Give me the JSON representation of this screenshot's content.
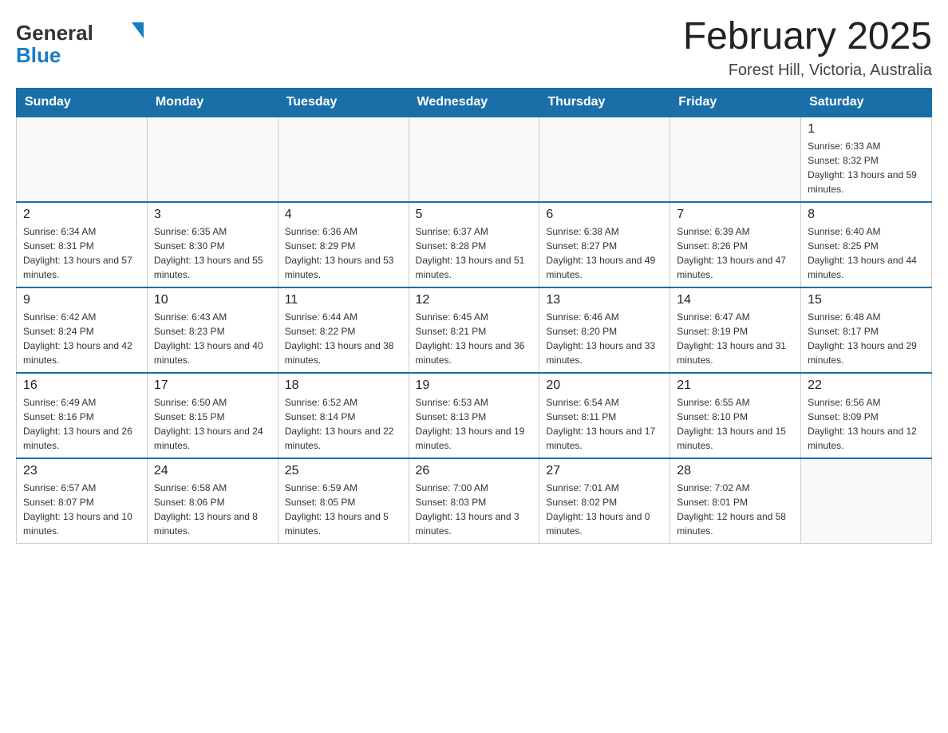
{
  "header": {
    "logo_general": "General",
    "logo_blue": "Blue",
    "month_title": "February 2025",
    "location": "Forest Hill, Victoria, Australia"
  },
  "days_of_week": [
    "Sunday",
    "Monday",
    "Tuesday",
    "Wednesday",
    "Thursday",
    "Friday",
    "Saturday"
  ],
  "weeks": [
    [
      {
        "day": "",
        "info": ""
      },
      {
        "day": "",
        "info": ""
      },
      {
        "day": "",
        "info": ""
      },
      {
        "day": "",
        "info": ""
      },
      {
        "day": "",
        "info": ""
      },
      {
        "day": "",
        "info": ""
      },
      {
        "day": "1",
        "info": "Sunrise: 6:33 AM\nSunset: 8:32 PM\nDaylight: 13 hours and 59 minutes."
      }
    ],
    [
      {
        "day": "2",
        "info": "Sunrise: 6:34 AM\nSunset: 8:31 PM\nDaylight: 13 hours and 57 minutes."
      },
      {
        "day": "3",
        "info": "Sunrise: 6:35 AM\nSunset: 8:30 PM\nDaylight: 13 hours and 55 minutes."
      },
      {
        "day": "4",
        "info": "Sunrise: 6:36 AM\nSunset: 8:29 PM\nDaylight: 13 hours and 53 minutes."
      },
      {
        "day": "5",
        "info": "Sunrise: 6:37 AM\nSunset: 8:28 PM\nDaylight: 13 hours and 51 minutes."
      },
      {
        "day": "6",
        "info": "Sunrise: 6:38 AM\nSunset: 8:27 PM\nDaylight: 13 hours and 49 minutes."
      },
      {
        "day": "7",
        "info": "Sunrise: 6:39 AM\nSunset: 8:26 PM\nDaylight: 13 hours and 47 minutes."
      },
      {
        "day": "8",
        "info": "Sunrise: 6:40 AM\nSunset: 8:25 PM\nDaylight: 13 hours and 44 minutes."
      }
    ],
    [
      {
        "day": "9",
        "info": "Sunrise: 6:42 AM\nSunset: 8:24 PM\nDaylight: 13 hours and 42 minutes."
      },
      {
        "day": "10",
        "info": "Sunrise: 6:43 AM\nSunset: 8:23 PM\nDaylight: 13 hours and 40 minutes."
      },
      {
        "day": "11",
        "info": "Sunrise: 6:44 AM\nSunset: 8:22 PM\nDaylight: 13 hours and 38 minutes."
      },
      {
        "day": "12",
        "info": "Sunrise: 6:45 AM\nSunset: 8:21 PM\nDaylight: 13 hours and 36 minutes."
      },
      {
        "day": "13",
        "info": "Sunrise: 6:46 AM\nSunset: 8:20 PM\nDaylight: 13 hours and 33 minutes."
      },
      {
        "day": "14",
        "info": "Sunrise: 6:47 AM\nSunset: 8:19 PM\nDaylight: 13 hours and 31 minutes."
      },
      {
        "day": "15",
        "info": "Sunrise: 6:48 AM\nSunset: 8:17 PM\nDaylight: 13 hours and 29 minutes."
      }
    ],
    [
      {
        "day": "16",
        "info": "Sunrise: 6:49 AM\nSunset: 8:16 PM\nDaylight: 13 hours and 26 minutes."
      },
      {
        "day": "17",
        "info": "Sunrise: 6:50 AM\nSunset: 8:15 PM\nDaylight: 13 hours and 24 minutes."
      },
      {
        "day": "18",
        "info": "Sunrise: 6:52 AM\nSunset: 8:14 PM\nDaylight: 13 hours and 22 minutes."
      },
      {
        "day": "19",
        "info": "Sunrise: 6:53 AM\nSunset: 8:13 PM\nDaylight: 13 hours and 19 minutes."
      },
      {
        "day": "20",
        "info": "Sunrise: 6:54 AM\nSunset: 8:11 PM\nDaylight: 13 hours and 17 minutes."
      },
      {
        "day": "21",
        "info": "Sunrise: 6:55 AM\nSunset: 8:10 PM\nDaylight: 13 hours and 15 minutes."
      },
      {
        "day": "22",
        "info": "Sunrise: 6:56 AM\nSunset: 8:09 PM\nDaylight: 13 hours and 12 minutes."
      }
    ],
    [
      {
        "day": "23",
        "info": "Sunrise: 6:57 AM\nSunset: 8:07 PM\nDaylight: 13 hours and 10 minutes."
      },
      {
        "day": "24",
        "info": "Sunrise: 6:58 AM\nSunset: 8:06 PM\nDaylight: 13 hours and 8 minutes."
      },
      {
        "day": "25",
        "info": "Sunrise: 6:59 AM\nSunset: 8:05 PM\nDaylight: 13 hours and 5 minutes."
      },
      {
        "day": "26",
        "info": "Sunrise: 7:00 AM\nSunset: 8:03 PM\nDaylight: 13 hours and 3 minutes."
      },
      {
        "day": "27",
        "info": "Sunrise: 7:01 AM\nSunset: 8:02 PM\nDaylight: 13 hours and 0 minutes."
      },
      {
        "day": "28",
        "info": "Sunrise: 7:02 AM\nSunset: 8:01 PM\nDaylight: 12 hours and 58 minutes."
      },
      {
        "day": "",
        "info": ""
      }
    ]
  ]
}
